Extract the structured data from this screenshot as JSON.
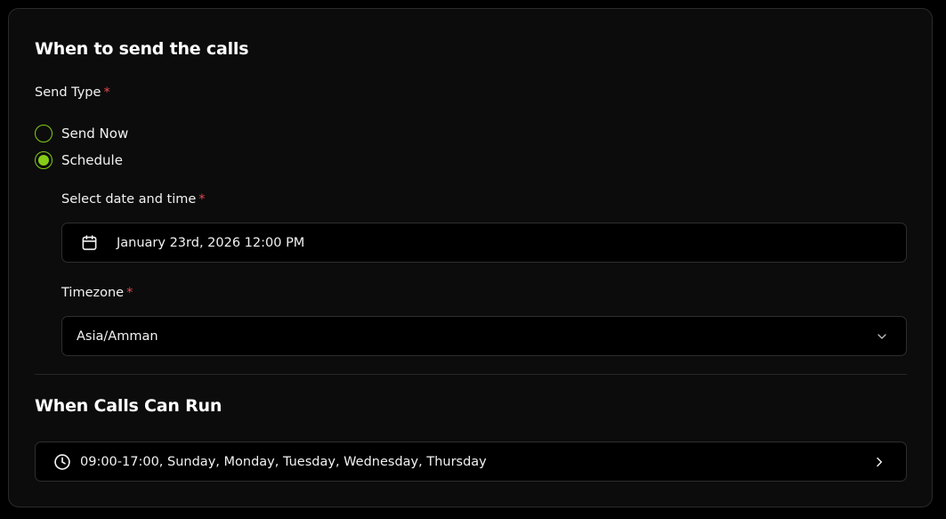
{
  "send_section": {
    "title": "When to send the calls",
    "send_type_label": "Send Type",
    "required_mark": "*",
    "options": [
      {
        "label": "Send Now",
        "selected": false
      },
      {
        "label": "Schedule",
        "selected": true
      }
    ],
    "datetime_label": "Select date and time",
    "datetime_value": "January 23rd, 2026 12:00 PM",
    "timezone_label": "Timezone",
    "timezone_value": "Asia/Amman"
  },
  "run_section": {
    "title": "When Calls Can Run",
    "schedule_summary": "09:00-17:00, Sunday, Monday, Tuesday, Wednesday, Thursday"
  },
  "colors": {
    "accent": "#84cc16",
    "required": "#e5484d",
    "card_background": "#0c0c0c",
    "border": "#2e2e2e"
  },
  "icons": {
    "datetime": "calendar-icon",
    "timezone": "chevron-down-icon",
    "schedule": "clock-icon",
    "schedule_open": "chevron-right-icon"
  }
}
